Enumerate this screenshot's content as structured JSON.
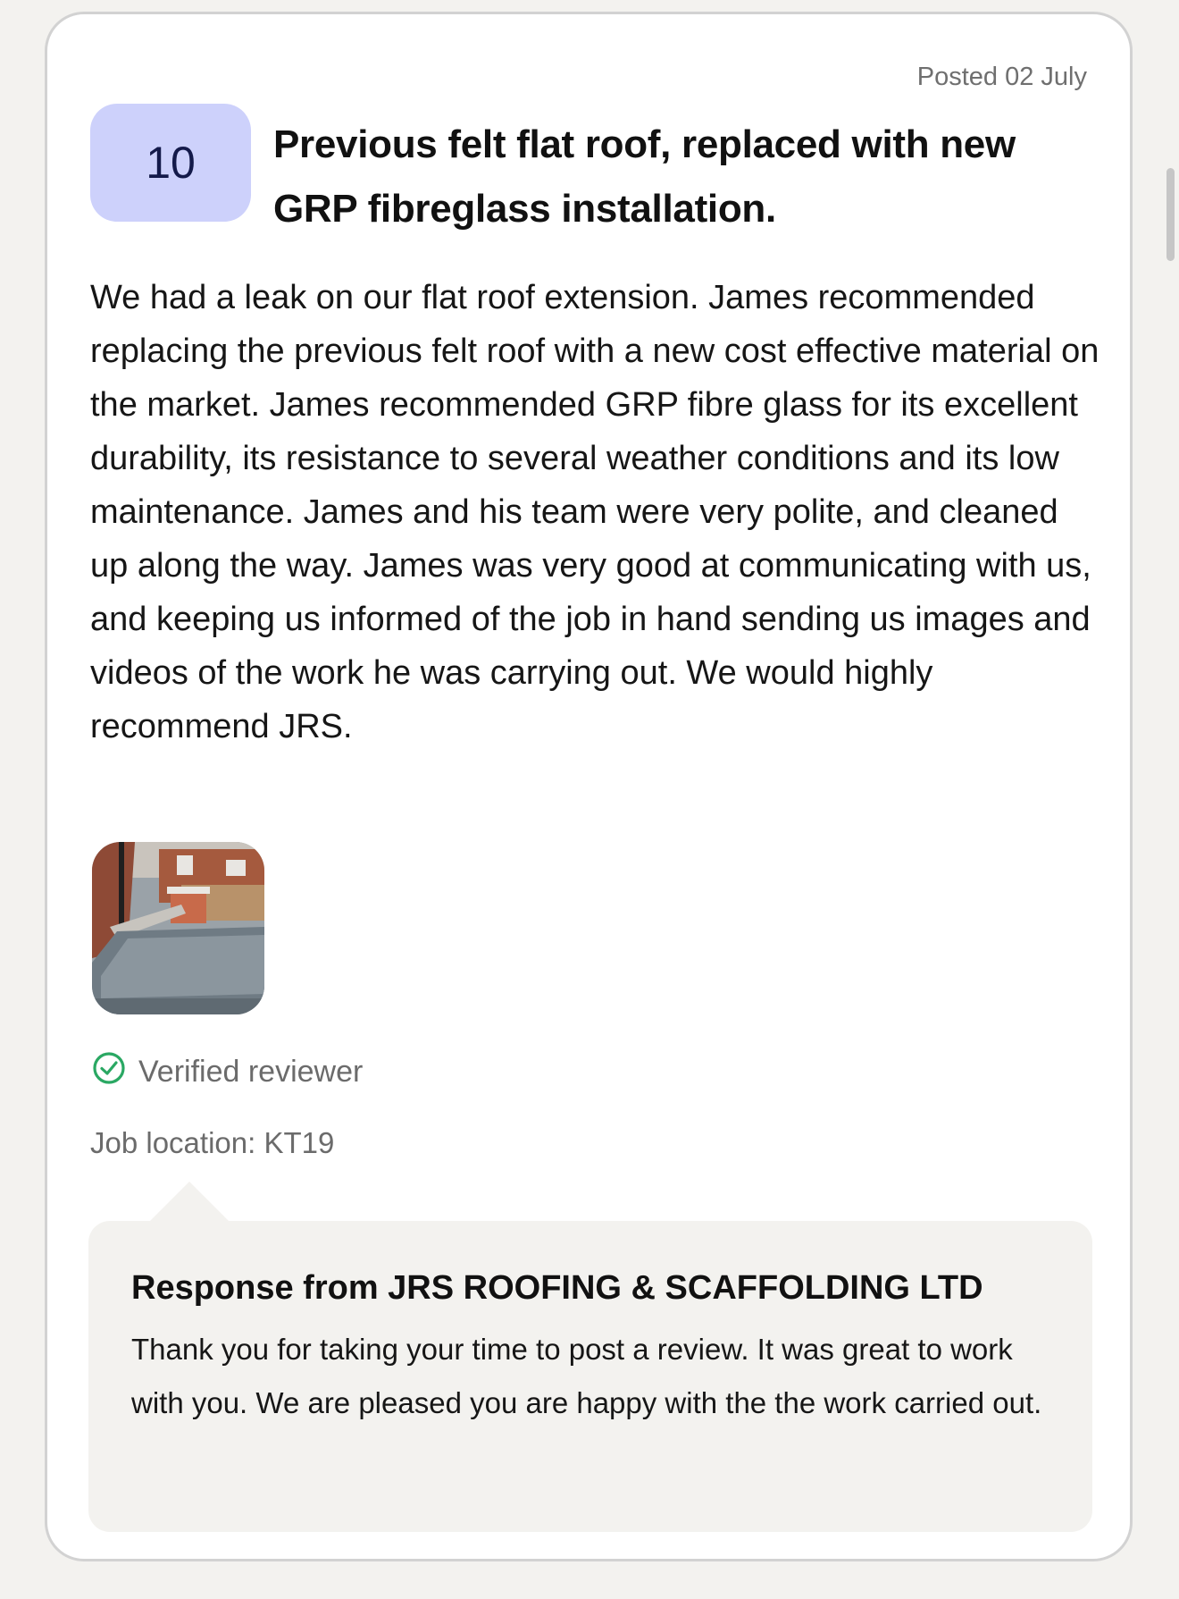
{
  "review": {
    "posted": "Posted 02 July",
    "score": "10",
    "title": "Previous felt flat roof, replaced with new GRP fibreglass installation.",
    "body": "We had a leak on our flat roof extension. James recommended replacing the previous felt roof with a new cost effective material on the market. James recommended GRP fibre glass for its excellent durability, its resistance to several weather conditions and its low maintenance. James and his team were very polite, and cleaned up along the way. James was very good at communicating with us, and keeping us informed of the job in hand sending us images and videos of the work he was carrying out. We would highly recommend JRS.",
    "verified_label": "Verified reviewer",
    "job_location": "Job location: KT19"
  },
  "response": {
    "title": "Response from JRS ROOFING & SCAFFOLDING LTD",
    "text": "Thank you for taking your time to post a review. It was great to work with you. We are pleased you are happy with the the work carried out."
  },
  "colors": {
    "score_bg": "#cdd1fb",
    "verified_icon": "#2aa863",
    "response_bg": "#f3f2ef"
  },
  "icons": {
    "verified": "check-circle-icon"
  }
}
